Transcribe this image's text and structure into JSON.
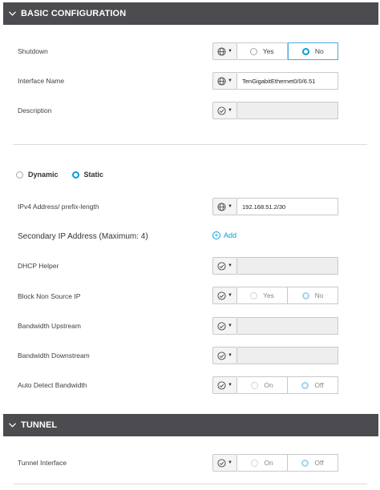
{
  "basic": {
    "header": "BASIC CONFIGURATION",
    "shutdown": {
      "label": "Shutdown",
      "options": [
        "Yes",
        "No"
      ],
      "selected": "No"
    },
    "interface_name": {
      "label": "Interface Name",
      "value": "TenGigabitEthernet0/0/6.51"
    },
    "description": {
      "label": "Description",
      "value": ""
    },
    "address_mode": {
      "options": [
        "Dynamic",
        "Static"
      ],
      "selected": "Static"
    },
    "ipv4": {
      "label": "IPv4 Address/ prefix-length",
      "value": "192.168.51.2/30"
    },
    "secondary": {
      "label": "Secondary IP Address (Maximum: 4)",
      "add_label": "Add"
    },
    "dhcp_helper": {
      "label": "DHCP Helper",
      "value": ""
    },
    "block_non_source": {
      "label": "Block Non Source IP",
      "options": [
        "Yes",
        "No"
      ],
      "selected": "No"
    },
    "bandwidth_upstream": {
      "label": "Bandwidth Upstream",
      "value": ""
    },
    "bandwidth_downstream": {
      "label": "Bandwidth Downstream",
      "value": ""
    },
    "auto_detect": {
      "label": "Auto Detect Bandwidth",
      "options": [
        "On",
        "Off"
      ],
      "selected": "Off"
    }
  },
  "tunnel": {
    "header": "TUNNEL",
    "tunnel_interface": {
      "label": "Tunnel Interface",
      "options": [
        "On",
        "Off"
      ],
      "selected": "Off"
    }
  },
  "icons": {
    "collapse": "chevron-down-icon",
    "global_scope": "globe-icon",
    "default_scope": "check-circle-icon",
    "add": "plus-circle-icon"
  },
  "colors": {
    "header_bg": "#4b4b50",
    "accent": "#049fd9",
    "disabled_field": "#eeeeee"
  }
}
